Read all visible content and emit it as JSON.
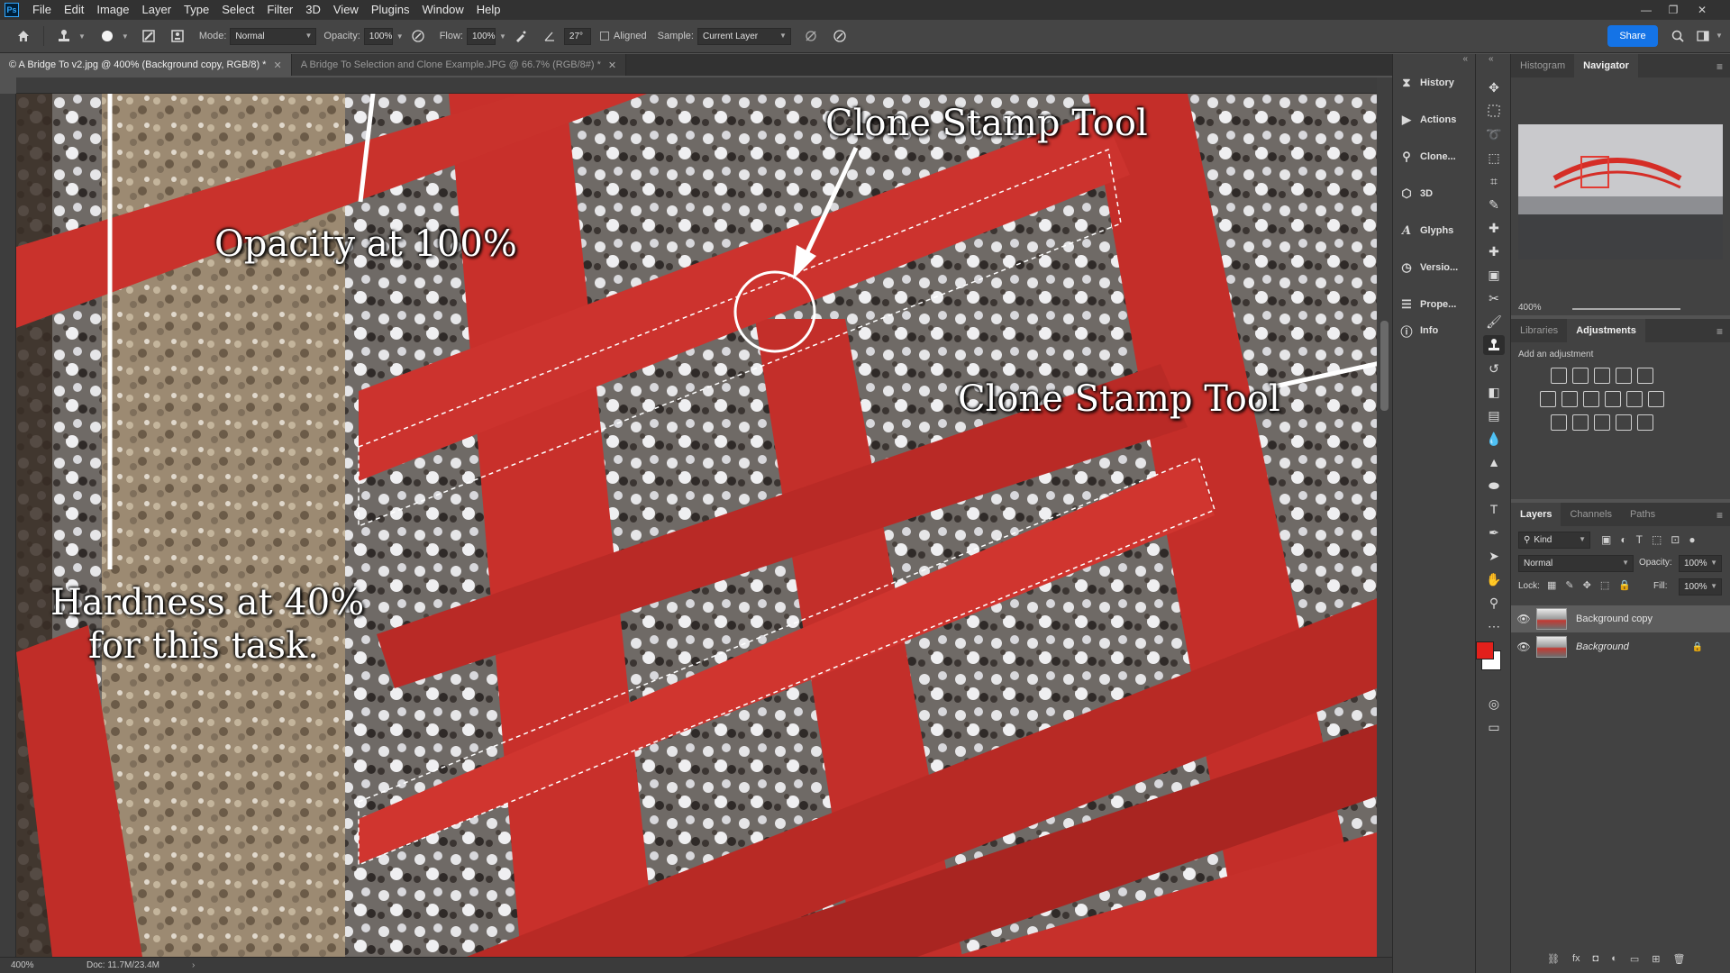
{
  "app": {
    "logo": "Ps"
  },
  "menu": [
    "File",
    "Edit",
    "Image",
    "Layer",
    "Type",
    "Select",
    "Filter",
    "3D",
    "View",
    "Plugins",
    "Window",
    "Help"
  ],
  "options": {
    "mode_label": "Mode:",
    "mode_value": "Normal",
    "opacity_label": "Opacity:",
    "opacity_value": "100%",
    "flow_label": "Flow:",
    "flow_value": "100%",
    "angle_value": "27°",
    "aligned_label": "Aligned",
    "sample_label": "Sample:",
    "sample_value": "Current Layer",
    "share_label": "Share"
  },
  "tabs": [
    {
      "label": "© A Bridge To v2.jpg @ 400% (Background copy, RGB/8) *",
      "active": true
    },
    {
      "label": "A Bridge To Selection and Clone Example.JPG @ 66.7% (RGB/8#) *",
      "active": false
    }
  ],
  "annotations": {
    "clone_top": "Clone Stamp Tool",
    "opacity": "Opacity at 100%",
    "clone_right": "Clone Stamp Tool",
    "hardness_line1": "Hardness at 40%",
    "hardness_line2": "for this task."
  },
  "status": {
    "zoom": "400%",
    "doc": "Doc: 11.7M/23.4M"
  },
  "dock": [
    {
      "label": "History",
      "icon": "history-icon"
    },
    {
      "label": "Actions",
      "icon": "play-icon"
    },
    {
      "label": "Clone...",
      "icon": "clone-source-icon"
    },
    {
      "label": "3D",
      "icon": "cube-icon"
    },
    {
      "label": "Glyphs",
      "icon": "glyph-icon"
    },
    {
      "label": "Versio...",
      "icon": "clock-icon"
    },
    {
      "label": "Prope...",
      "icon": "sliders-icon"
    },
    {
      "label": "Info",
      "icon": "info-icon"
    }
  ],
  "panels": {
    "top_tabs": [
      "Histogram",
      "Navigator"
    ],
    "nav_zoom": "400%",
    "adj_tabs": [
      "Libraries",
      "Adjustments"
    ],
    "add_adjustment": "Add an adjustment",
    "layer_tabs": [
      "Layers",
      "Channels",
      "Paths"
    ],
    "kind_label": "Kind",
    "blend_mode": "Normal",
    "opacity_label": "Opacity:",
    "opacity_value": "100%",
    "lock_label": "Lock:",
    "fill_label": "Fill:",
    "fill_value": "100%",
    "layers": [
      {
        "name": "Background copy",
        "selected": true
      },
      {
        "name": "Background",
        "selected": false,
        "locked": true
      }
    ]
  },
  "colors": {
    "foreground": "#e3201b",
    "background": "#ffffff",
    "accent": "#1473e6"
  }
}
